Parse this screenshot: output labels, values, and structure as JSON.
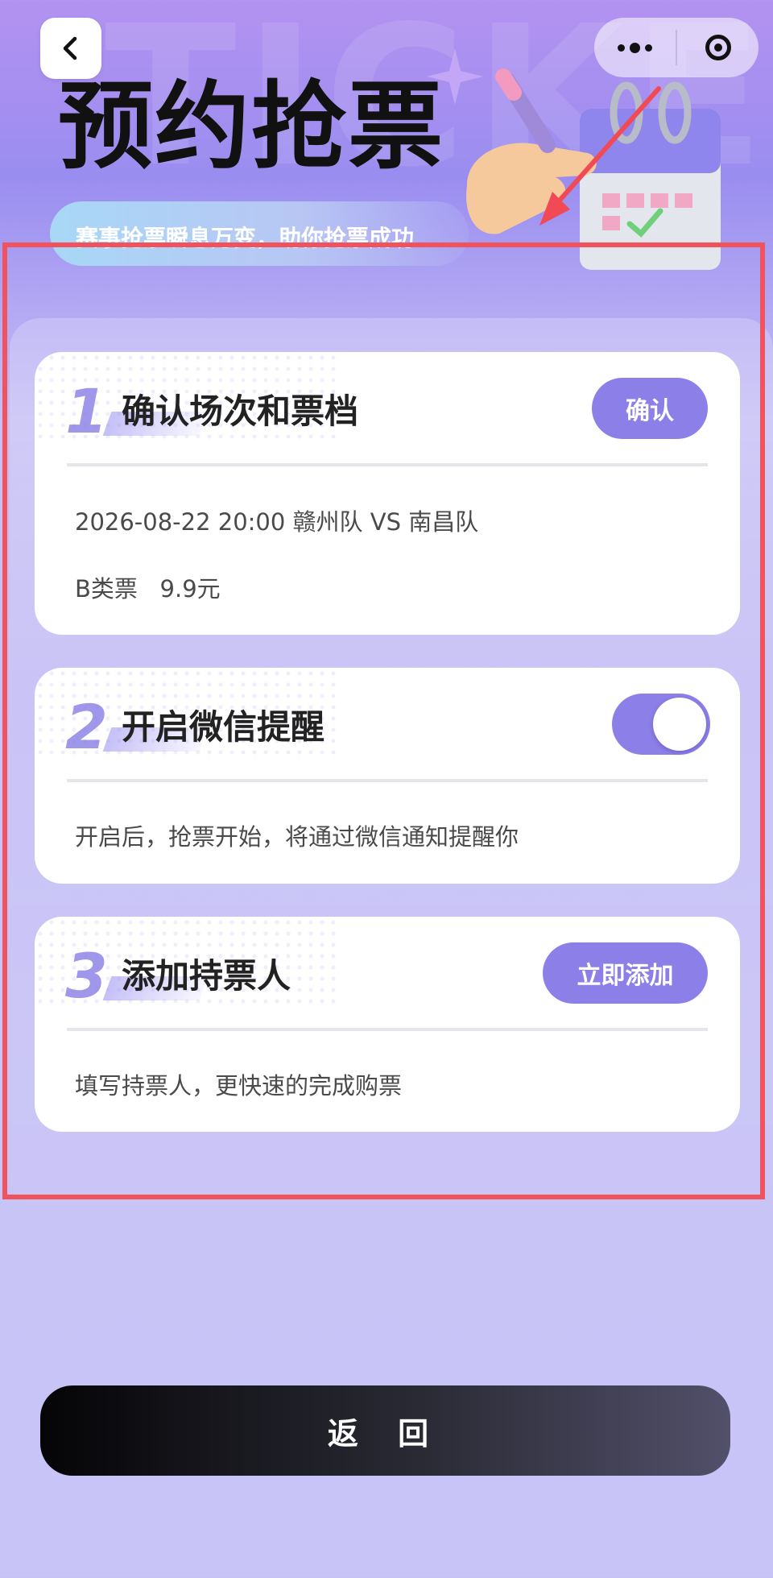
{
  "header": {
    "watermark": "TICKET",
    "title": "预约抢票",
    "subtitle": "赛事抢票瞬息万变，助你抢票成功",
    "back_icon": "chevron-left-icon",
    "menu_icon": "more-dots-icon",
    "close_icon": "target-icon"
  },
  "steps": [
    {
      "number": "1",
      "title": "确认场次和票档",
      "button_label": "确认",
      "lines": [
        "2026-08-22 20:00 赣州队 VS 南昌队",
        "B类票   9.9元"
      ]
    },
    {
      "number": "2",
      "title": "开启微信提醒",
      "toggle_on": true,
      "lines": [
        "开启后，抢票开始，将通过微信通知提醒你"
      ]
    },
    {
      "number": "3",
      "title": "添加持票人",
      "button_label": "立即添加",
      "lines": [
        "填写持票人，更快速的完成购票"
      ]
    }
  ],
  "footer": {
    "return_label": "返 回"
  },
  "colors": {
    "accent": "#8c80e8",
    "highlight_border": "#f1535e",
    "annotation_arrow": "#f14a55"
  }
}
